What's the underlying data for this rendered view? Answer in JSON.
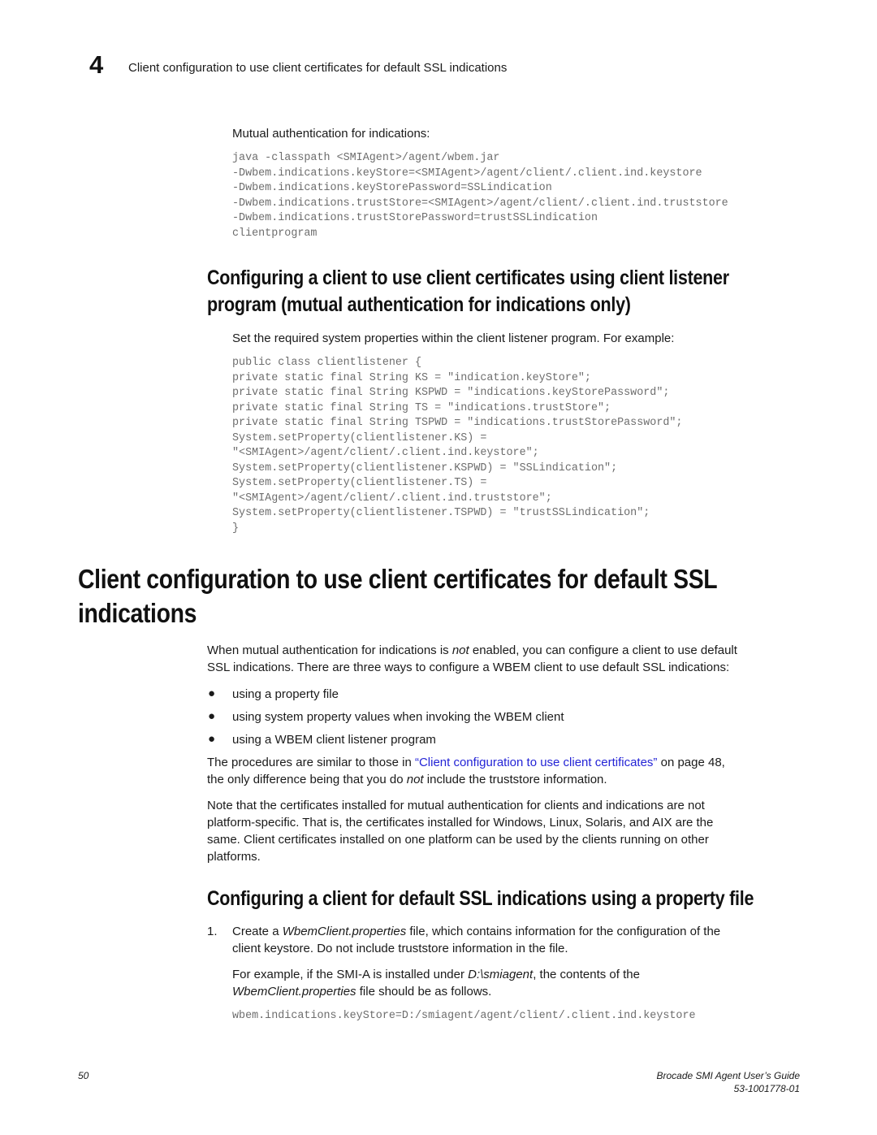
{
  "header": {
    "chapter_number": "4",
    "running_title": "Client configuration to use client certificates for default SSL indications"
  },
  "mutual_auth": {
    "label": "Mutual authentication for indications:",
    "code_lines": [
      "java -classpath <SMIAgent>/agent/wbem.jar",
      "-Dwbem.indications.keyStore=<SMIAgent>/agent/client/.client.ind.keystore",
      "-Dwbem.indications.keyStorePassword=SSLindication",
      "-Dwbem.indications.trustStore=<SMIAgent>/agent/client/.client.ind.truststore",
      "-Dwbem.indications.trustStorePassword=trustSSLindication",
      "clientprogram"
    ]
  },
  "section_listener": {
    "heading_line1": "Configuring a client to use client certificates using client listener",
    "heading_line2": "program (mutual authentication for indications only)",
    "intro": "Set the required system properties within the client listener program. For example:",
    "code_lines": [
      "public class clientlistener {",
      "private static final String KS = \"indication.keyStore\";",
      "private static final String KSPWD = \"indications.keyStorePassword\";",
      "private static final String TS = \"indications.trustStore\";",
      "private static final String TSPWD = \"indications.trustStorePassword\";",
      "System.setProperty(clientlistener.KS) =",
      "\"<SMIAgent>/agent/client/.client.ind.keystore\";",
      "System.setProperty(clientlistener.KSPWD) = \"SSLindication\";",
      "System.setProperty(clientlistener.TS) =",
      "\"<SMIAgent>/agent/client/.client.ind.truststore\";",
      "System.setProperty(clientlistener.TSPWD) = \"trustSSLindication\";",
      "}"
    ]
  },
  "section_default_ssl": {
    "heading_line1": "Client configuration to use client certificates for default SSL",
    "heading_line2": "indications",
    "para1_before": "When mutual authentication for indications is ",
    "para1_em": "not",
    "para1_after": " enabled, you can configure a client to use default",
    "para1_line2": "SSL indications. There are three ways to configure a WBEM client to use default SSL indications:",
    "bullets": [
      "using a property file",
      "using system property values when invoking the WBEM client",
      "using a WBEM client listener program"
    ],
    "para2_before": "The procedures are similar to those in ",
    "para2_link": "“Client configuration to use client certificates”",
    "para2_after": " on page 48,",
    "para2_line2_before": "the only difference being that you do ",
    "para2_line2_em": "not",
    "para2_line2_after": " include the truststore information.",
    "para3_lines": [
      "Note that the certificates installed for mutual authentication for clients and indications are not",
      "platform-specific. That is, the certificates installed for Windows, Linux, Solaris, and AIX are the",
      "same. Client certificates installed on one platform can be used by the clients running on other",
      "platforms."
    ]
  },
  "section_property_file": {
    "heading": "Configuring a client for default SSL indications using a property file",
    "step_number": "1.",
    "step_before": "Create a ",
    "step_em": "WbemClient.properties",
    "step_after": " file, which contains information for the configuration of the",
    "step_line2": "client keystore. Do not include truststore information in the file.",
    "example_before": "For example, if the SMI-A is installed under ",
    "example_em": "D:\\smiagent",
    "example_after": ", the contents of the",
    "example_line2_em": "WbemClient.properties",
    "example_line2_after": " file should be as follows.",
    "code_line": "wbem.indications.keyStore=D:/smiagent/agent/client/.client.ind.keystore"
  },
  "footer": {
    "page_number": "50",
    "guide_title": "Brocade SMI Agent User’s Guide",
    "doc_number": "53-1001778-01"
  }
}
